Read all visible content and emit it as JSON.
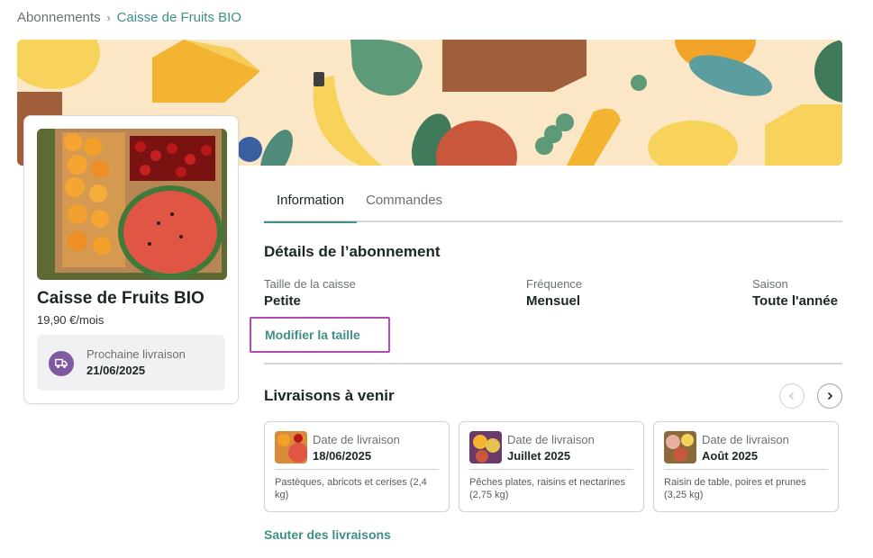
{
  "breadcrumb": {
    "root": "Abonnements",
    "separator": "›",
    "current": "Caisse de Fruits BIO"
  },
  "product": {
    "title": "Caisse de Fruits BIO",
    "price": "19,90 €/mois",
    "next_delivery_label": "Prochaine livraison",
    "next_delivery_date": "21/06/2025"
  },
  "tabs": [
    {
      "label": "Information"
    },
    {
      "label": "Commandes"
    }
  ],
  "details": {
    "title": "Détails de l’abonnement",
    "size_label": "Taille de la caisse",
    "size_value": "Petite",
    "frequency_label": "Fréquence",
    "frequency_value": "Mensuel",
    "season_label": "Saison",
    "season_value": "Toute l'année",
    "modify_link": "Modifier la taille"
  },
  "upcoming": {
    "title": "Livraisons à venir",
    "deliveries": [
      {
        "label": "Date de livraison",
        "date": "18/06/2025",
        "description": "Pastèques, abricots et cerises (2,4 kg)"
      },
      {
        "label": "Date de livraison",
        "date": "Juillet 2025",
        "description": "Pêches plates, raisins et nectarines (2,75 kg)"
      },
      {
        "label": "Date de livraison",
        "date": "Août 2025",
        "description": "Raisin de table, poires et prunes (3,25 kg)"
      }
    ],
    "skip_link": "Sauter des livraisons"
  },
  "colors": {
    "accent": "#3f8f87",
    "highlight_border": "#b44bb0",
    "truck_badge": "#7f5aa2"
  },
  "icons": {
    "prev": "chevron-left-icon",
    "next": "chevron-right-icon",
    "truck": "truck-icon",
    "breadcrumb_sep": "chevron-right-icon"
  }
}
